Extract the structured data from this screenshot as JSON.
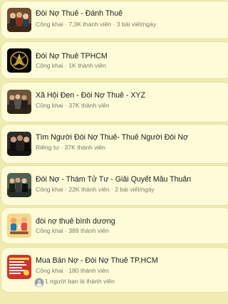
{
  "groups": [
    {
      "title": "Đòi Nợ Thuê - Đánh Thuê",
      "meta": "Công khai · 7,3K thành viên · 3 bài viết/ngày",
      "icon": "group-photo-icon"
    },
    {
      "title": "Đòi Nợ Thuê TPHCM",
      "meta": "Công khai · 1K thành viên",
      "icon": "logo-icon"
    },
    {
      "title": "Xã Hội Đen - Đòi Nợ Thuê - XYZ",
      "meta": "Công khai · 37K thành viên",
      "icon": "group-photo-icon"
    },
    {
      "title": "Tìm Người Đòi Nợ Thuê- Thuê Người Đòi Nợ",
      "meta": "Riêng tư · 37K thành viên",
      "icon": "group-photo-icon"
    },
    {
      "title": "Đòi Nợ - Thám Tử Tư - Giải Quyết Mâu Thuẫn",
      "meta": "Công khai · 22K thành viên · 2 bài viết/ngày",
      "icon": "group-photo-icon"
    },
    {
      "title": "đòi nợ thuê bình dương",
      "meta": "Công khai · 389 thành viên",
      "icon": "illustration-icon"
    },
    {
      "title": "Mua Bán Nợ - Đòi Nợ Thuê TP.HCM",
      "meta": "Công khai · 180 thành viên",
      "friends": "1 người bạn là thành viên",
      "icon": "document-icon"
    }
  ],
  "colors": {
    "background": "#f0ebb1",
    "card": "#fdfbd8",
    "title": "#1b1b1b",
    "meta": "#7c7a68"
  }
}
